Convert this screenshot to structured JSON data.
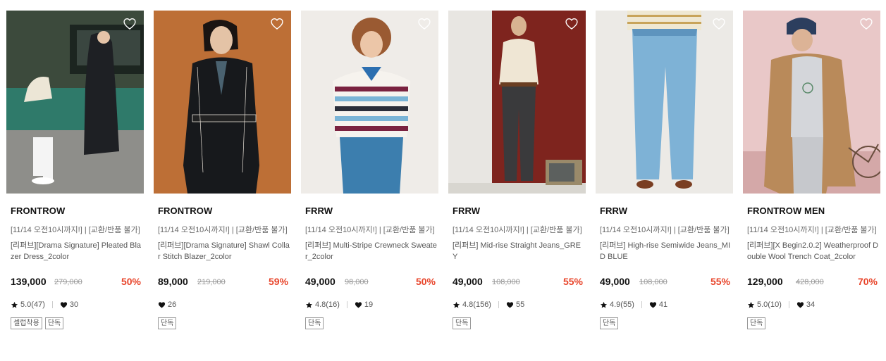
{
  "products": [
    {
      "brand": "FRONTROW",
      "promo": "[11/14 오전10시까지!] | [교환/반품 불가]",
      "name": "[리퍼브][Drama Signature] Pleated Blazer Dress_2color",
      "price": "139,000",
      "original_price": "279,000",
      "discount": "50%",
      "rating": "5.0(47)",
      "likes": "30",
      "tags": [
        "셀럽착용",
        "단독"
      ],
      "image_subject": "woman in black pleated dress sitting outside cafe"
    },
    {
      "brand": "FRONTROW",
      "promo": "[11/14 오전10시까지!] | [교환/반품 불가]",
      "name": "[리퍼브][Drama Signature] Shawl Collar Stitch Blazer_2color",
      "price": "89,000",
      "original_price": "219,000",
      "discount": "59%",
      "rating": "",
      "likes": "26",
      "tags": [
        "단독"
      ],
      "image_subject": "woman in black belted blazer on orange background"
    },
    {
      "brand": "FRRW",
      "promo": "[11/14 오전10시까지!] | [교환/반품 불가]",
      "name": "[리퍼브] Multi-Stripe Crewneck Sweater_2color",
      "price": "49,000",
      "original_price": "98,000",
      "discount": "50%",
      "rating": "4.8(16)",
      "likes": "19",
      "tags": [
        "단독"
      ],
      "image_subject": "curly haired woman in multi-stripe sweater"
    },
    {
      "brand": "FRRW",
      "promo": "[11/14 오전10시까지!] | [교환/반품 불가]",
      "name": "[리퍼브] Mid-rise Straight Jeans_GREY",
      "price": "49,000",
      "original_price": "108,000",
      "discount": "55%",
      "rating": "4.8(156)",
      "likes": "55",
      "tags": [
        "단독"
      ],
      "image_subject": "man in grey straight jeans with vintage tv"
    },
    {
      "brand": "FRRW",
      "promo": "[11/14 오전10시까지!] | [교환/반품 불가]",
      "name": "[리퍼브] High-rise Semiwide Jeans_MID BLUE",
      "price": "49,000",
      "original_price": "108,000",
      "discount": "55%",
      "rating": "4.9(55)",
      "likes": "41",
      "tags": [
        "단독"
      ],
      "image_subject": "light blue wide jeans with striped top"
    },
    {
      "brand": "FRONTROW MEN",
      "promo": "[11/14 오전10시까지!] | [교환/반품 불가]",
      "name": "[리퍼브][X Begin2.0.2] Weatherproof Double Wool Trench Coat_2color",
      "price": "129,000",
      "original_price": "428,000",
      "discount": "70%",
      "rating": "5.0(10)",
      "likes": "34",
      "tags": [
        "단독"
      ],
      "image_subject": "man in camel trench coat with bicycle"
    }
  ],
  "colors": {
    "discount": "#e8442a",
    "text": "#111111",
    "muted": "#999999"
  },
  "icons": {
    "wishlist": "heart-outline-icon",
    "rating": "star-icon",
    "likes": "heart-filled-icon"
  }
}
